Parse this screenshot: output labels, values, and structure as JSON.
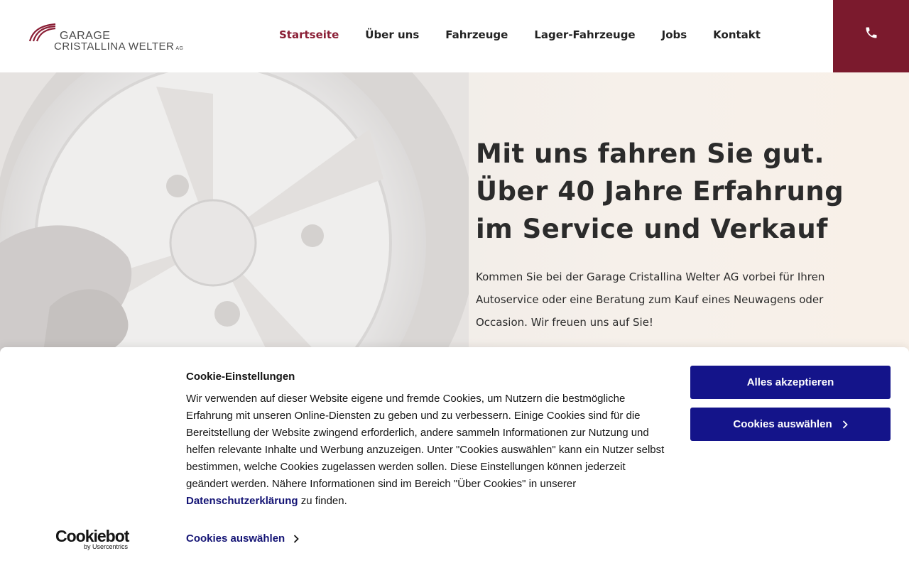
{
  "header": {
    "logo": {
      "line1": "GARAGE",
      "line2": "CRISTALLINA WELTER",
      "suffix": "AG"
    },
    "nav": [
      {
        "label": "Startseite",
        "active": true
      },
      {
        "label": "Über uns",
        "active": false
      },
      {
        "label": "Fahrzeuge",
        "active": false
      },
      {
        "label": "Lager-Fahrzeuge",
        "active": false
      },
      {
        "label": "Jobs",
        "active": false
      },
      {
        "label": "Kontakt",
        "active": false
      }
    ],
    "phone_icon": "phone-icon"
  },
  "hero": {
    "title": "Mit uns fahren Sie gut. Über 40 Jahre Erfahrung im Service und Verkauf",
    "text": "Kommen Sie bei der Garage Cristallina Welter AG vorbei für Ihren Autoservice oder eine Beratung zum Kauf eines Neuwagens oder Occasion. Wir freuen uns auf Sie!"
  },
  "cookie": {
    "title": "Cookie-Einstellungen",
    "body_before": "Wir verwenden auf dieser Website eigene und fremde Cookies, um Nutzern die bestmögliche Erfahrung mit unseren Online-Diensten zu geben und zu verbessern. Einige Cookies sind für die Bereitstellung der Website zwingend erforderlich, andere sammeln Informationen zur Nutzung und helfen relevante Inhalte und Werbung anzuzeigen. Unter \"Cookies auswählen\" kann ein Nutzer selbst bestimmen, welche Cookies zugelassen werden sollen. Diese Einstellungen können jederzeit geändert werden. Nähere Informationen sind im Bereich \"Über Cookies\" in unserer ",
    "privacy_link": "Datenschutzerklärung",
    "body_after": " zu finden.",
    "accept_label": "Alles akzeptieren",
    "select_label": "Cookies auswählen",
    "select_link": "Cookies auswählen",
    "brand": {
      "name": "Cookiebot",
      "by": "by Usercentrics"
    }
  },
  "colors": {
    "accent": "#8a1e35",
    "phone_bg": "#7b1a2d",
    "button_bg": "#14148a",
    "link": "#141475"
  }
}
